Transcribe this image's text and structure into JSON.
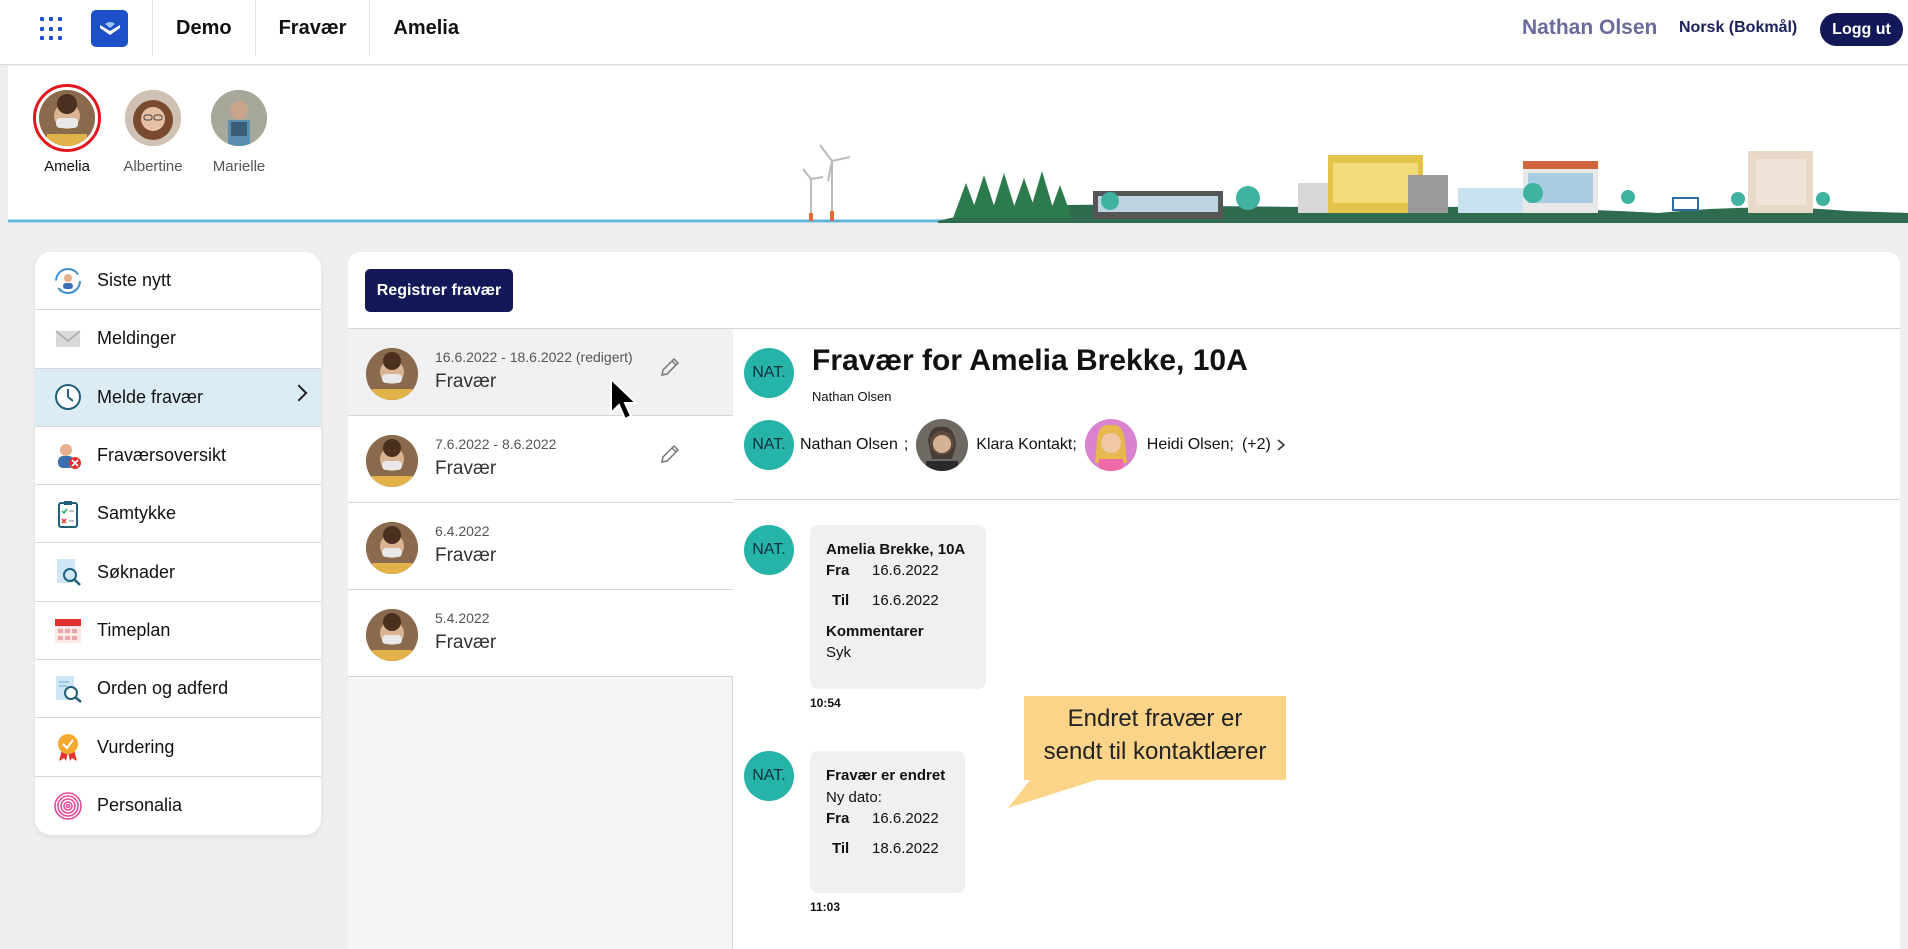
{
  "topbar": {
    "nav": [
      "Demo",
      "Fravær",
      "Amelia"
    ],
    "user_name": "Nathan Olsen",
    "language": "Norsk (Bokmål)",
    "logout_label": "Logg ut"
  },
  "children": [
    {
      "name": "Amelia",
      "active": true
    },
    {
      "name": "Albertine",
      "active": false
    },
    {
      "name": "Marielle",
      "active": false
    }
  ],
  "sidebar": {
    "items": [
      {
        "label": "Siste nytt",
        "icon": "news-refresh-icon"
      },
      {
        "label": "Meldinger",
        "icon": "envelope-icon"
      },
      {
        "label": "Melde fravær",
        "icon": "clock-icon",
        "active": true
      },
      {
        "label": "Fraværsoversikt",
        "icon": "person-absence-icon"
      },
      {
        "label": "Samtykke",
        "icon": "clipboard-check-icon"
      },
      {
        "label": "Søknader",
        "icon": "document-search-icon"
      },
      {
        "label": "Timeplan",
        "icon": "calendar-icon"
      },
      {
        "label": "Orden og adferd",
        "icon": "document-magnify-icon"
      },
      {
        "label": "Vurdering",
        "icon": "award-badge-icon"
      },
      {
        "label": "Personalia",
        "icon": "fingerprint-icon"
      }
    ]
  },
  "main": {
    "register_label": "Registrer fravær",
    "absences": [
      {
        "date": "16.6.2022 - 18.6.2022 (redigert)",
        "type": "Fravær",
        "editable": true,
        "selected": true
      },
      {
        "date": "7.6.2022 - 8.6.2022",
        "type": "Fravær",
        "editable": true,
        "selected": false
      },
      {
        "date": "6.4.2022",
        "type": "Fravær",
        "editable": false,
        "selected": false
      },
      {
        "date": "5.4.2022",
        "type": "Fravær",
        "editable": false,
        "selected": false
      }
    ]
  },
  "detail": {
    "avatar_initials": "NAT.",
    "title": "Fravær for Amelia Brekke, 10A",
    "author": "Nathan Olsen",
    "recipients": {
      "r1": "Nathan Olsen",
      "sep1": ";",
      "r2": "Klara Kontakt;",
      "r3": "Heidi Olsen;",
      "more": "(+2)"
    },
    "messages": [
      {
        "heading": "Amelia Brekke, 10A",
        "from_label": "Fra",
        "from": "16.6.2022",
        "to_label": "Til",
        "to": "16.6.2022",
        "comment_label": "Kommentarer",
        "comment": "Syk",
        "time": "10:54"
      },
      {
        "heading": "Fravær er endret",
        "note": "Ny dato:",
        "from_label": "Fra",
        "from": "16.6.2022",
        "to_label": "Til",
        "to": "18.6.2022",
        "time": "11:03"
      }
    ]
  },
  "callout": {
    "line1": "Endret fravær er",
    "line2": "sendt til kontaktlærer"
  },
  "colors": {
    "navy": "#131859",
    "teal_avatar": "#26b3a8",
    "active_item": "#dcecf5",
    "callout": "#fbd48a",
    "brand_blue": "#1d4fc6"
  }
}
